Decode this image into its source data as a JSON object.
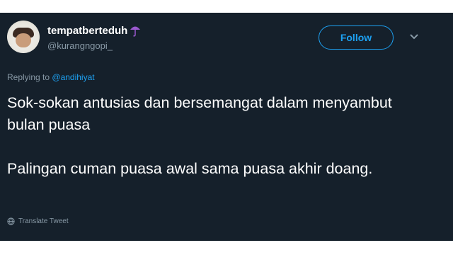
{
  "author": {
    "display_name": "tempatberteduh",
    "handle": "@kurangngopi_",
    "name_emoji": "umbrella-icon"
  },
  "follow_button": {
    "label": "Follow"
  },
  "menu": {
    "icon": "chevron-down-icon"
  },
  "reply": {
    "prefix": "Replying to",
    "mention": "@andihiyat"
  },
  "tweet": {
    "paragraphs": [
      "Sok-sokan antusias dan bersemangat dalam menyambut bulan puasa",
      "Palingan cuman puasa awal sama puasa akhir doang."
    ]
  },
  "translate": {
    "label": "Translate Tweet",
    "icon": "globe-icon"
  },
  "colors": {
    "background": "#15202b",
    "accent": "#1da1f2",
    "secondary_text": "#8899a6",
    "primary_text": "#ffffff"
  }
}
